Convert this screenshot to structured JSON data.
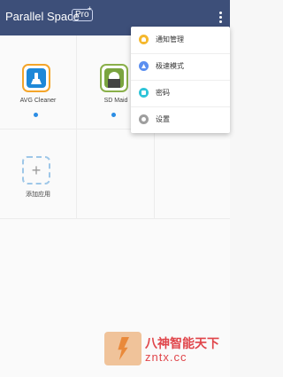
{
  "appbar": {
    "title": "Parallel Space",
    "badge": "Pro",
    "badge_mark": "+",
    "background": "#3d4f79"
  },
  "apps": [
    {
      "label": "AVG Cleaner",
      "icon": "avg-cleaner-icon",
      "active": true
    },
    {
      "label": "SD Maid",
      "icon": "sd-maid-icon",
      "active": true
    }
  ],
  "add_app": {
    "label": "添加应用",
    "glyph": "+"
  },
  "menu": {
    "items": [
      {
        "label": "通知管理",
        "icon": "bell-icon",
        "color": "#f5b82e"
      },
      {
        "label": "极速模式",
        "icon": "rocket-icon",
        "color": "#5b8ff0"
      },
      {
        "label": "密码",
        "icon": "lock-icon",
        "color": "#2ec4d8"
      },
      {
        "label": "设置",
        "icon": "gear-icon",
        "color": "#9e9e9e"
      }
    ]
  },
  "watermark": {
    "text": "八神智能天下",
    "url": "zntx.cc"
  },
  "colors": {
    "accent": "#2b8de4"
  }
}
